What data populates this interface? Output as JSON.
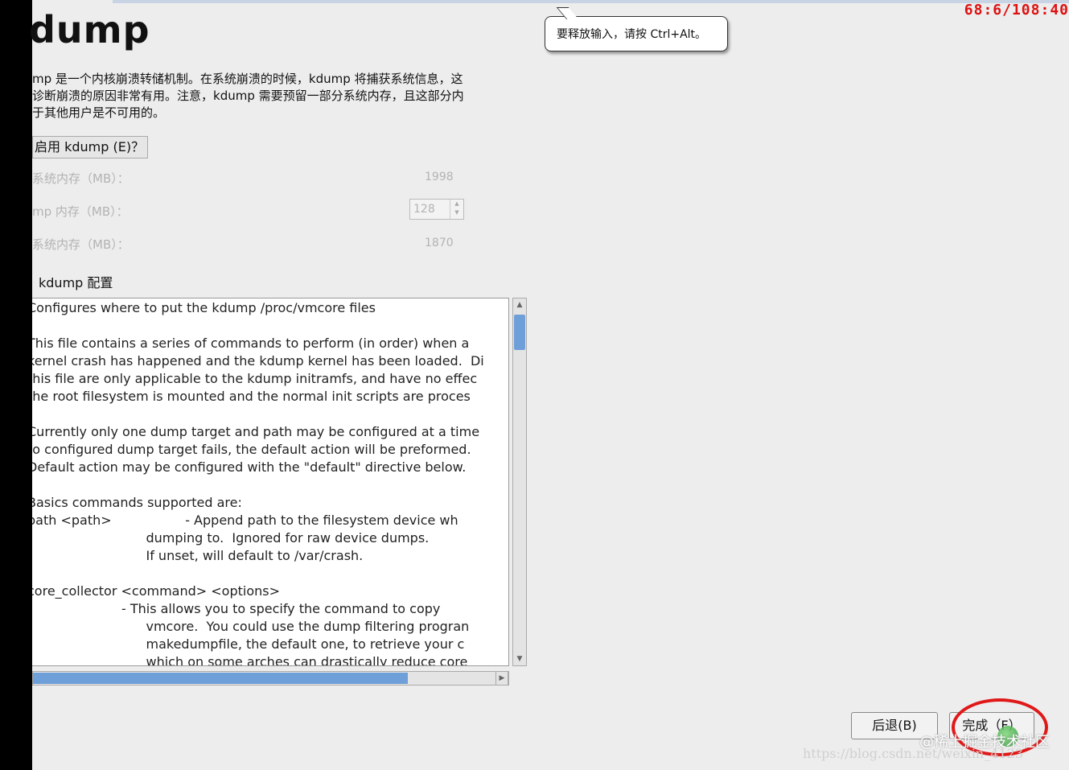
{
  "title": "dump",
  "tooltip": "要释放输入，请按 Ctrl+Alt。",
  "osd_counter": "68:6/108:40",
  "description_lines": [
    "mp 是一个内核崩溃转储机制。在系统崩溃的时候，kdump 将捕获系统信息，这",
    "诊断崩溃的原因非常有用。注意，kdump 需要预留一部分系统内存，且这部分内",
    "于其他用户是不可用的。"
  ],
  "enable_label": "启用 kdump (E)？",
  "memory": {
    "total_label": "系统内存（MB）：",
    "total_value": "1998",
    "kdump_label": "mp 内存（MB）：",
    "kdump_value": "128",
    "usable_label": "系统内存（MB）：",
    "usable_value": "1870"
  },
  "config_label": "kdump 配置",
  "config_text": "Configures where to put the kdump /proc/vmcore files\n\nThis file contains a series of commands to perform (in order) when a\nkernel crash has happened and the kdump kernel has been loaded.  Di\nthis file are only applicable to the kdump initramfs, and have no effec\nthe root filesystem is mounted and the normal init scripts are proces\n\nCurrently only one dump target and path may be configured at a time\nto configured dump target fails, the default action will be preformed.\nDefault action may be configured with the \"default\" directive below.\n\nBasics commands supported are:\npath <path>                  - Append path to the filesystem device wh\n                             dumping to.  Ignored for raw device dumps.\n                             If unset, will default to /var/crash.\n\ncore_collector <command> <options>\n                       - This allows you to specify the command to copy\n                             vmcore.  You could use the dump filtering progran\n                             makedumpfile, the default one, to retrieve your c\n                             which on some arches can drastically reduce core\n                             size. See /usr/sbin/makedumpfile --help for a list o",
  "buttons": {
    "back": "后退(B)",
    "finish": "完成（F）"
  },
  "watermark": {
    "line1": "@稀土掘金技术社区",
    "line2": "https://blog.csdn.net/weixin_4123"
  }
}
